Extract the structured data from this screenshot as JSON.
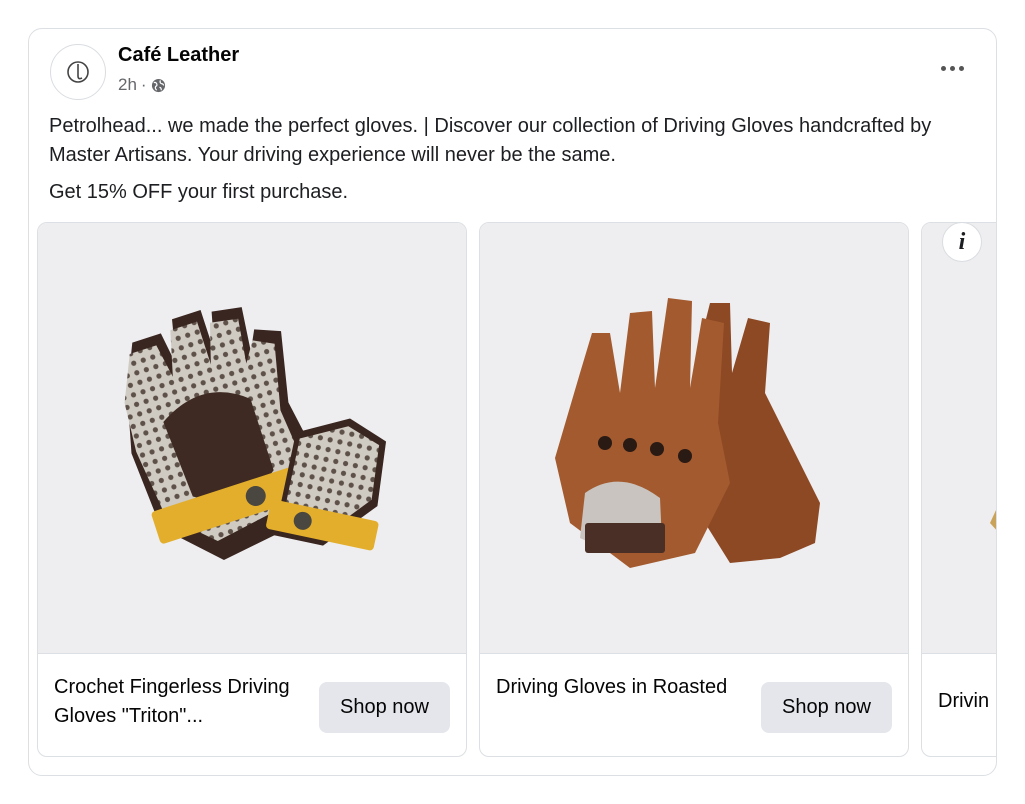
{
  "post": {
    "page_name": "Café Leather",
    "time": "2h",
    "separator": "·",
    "body_text": "Petrolhead... we made the perfect gloves. | Discover our collection of Driving Gloves handcrafted by Master Artisans. Your driving experience will never be the same.",
    "offer_text": "Get 15% OFF your first purchase."
  },
  "icons": {
    "avatar": "logo-c-icon",
    "audience": "globe-icon",
    "more": "more-horizontal-icon",
    "info": "info-icon"
  },
  "info_label": "i",
  "carousel": {
    "items": [
      {
        "title": "Crochet Fingerless Driving Gloves \"Triton\"...",
        "cta": "Shop now"
      },
      {
        "title": "Driving Gloves in Roasted",
        "cta": "Shop now"
      },
      {
        "title": "Drivin",
        "cta": ""
      }
    ]
  },
  "colors": {
    "text": "#050505",
    "secondary": "#65676b",
    "button_bg": "#e4e6eb",
    "image_bg": "#eeeef0",
    "border": "#dcdfe3",
    "glove_crochet": "#d8d4cc",
    "glove_dark": "#3a2620",
    "glove_yellow": "#e2ae2c",
    "glove_tan": "#a35a2e"
  }
}
